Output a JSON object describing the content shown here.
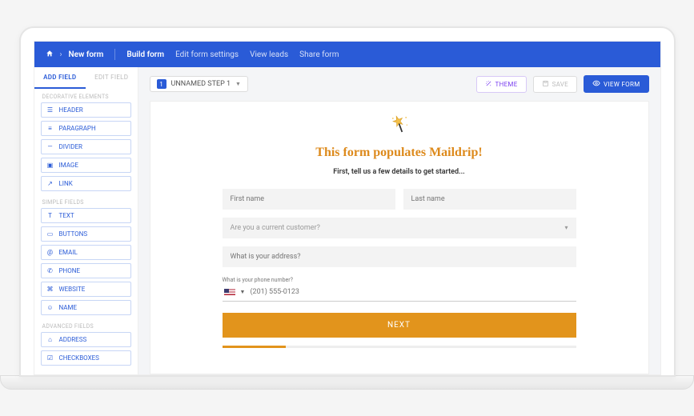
{
  "breadcrumb": {
    "current": "New form"
  },
  "nav": {
    "build": "Build form",
    "settings": "Edit form settings",
    "leads": "View leads",
    "share": "Share form"
  },
  "sidebar": {
    "tabs": {
      "add": "ADD FIELD",
      "edit": "EDIT FIELD"
    },
    "groups": {
      "decorative": "DECORATIVE ELEMENTS",
      "simple": "SIMPLE FIELDS",
      "advanced": "ADVANCED FIELDS"
    },
    "items": {
      "header": "HEADER",
      "paragraph": "PARAGRAPH",
      "divider": "DIVIDER",
      "image": "IMAGE",
      "link": "LINK",
      "text": "TEXT",
      "buttons": "BUTTONS",
      "email": "EMAIL",
      "phone": "PHONE",
      "website": "WEBSITE",
      "name": "NAME",
      "address": "ADDRESS",
      "checkboxes": "CHECKBOXES"
    }
  },
  "toolbar": {
    "step_badge": "1",
    "step_label": "UNNAMED STEP 1",
    "theme": "THEME",
    "save": "SAVE",
    "view": "VIEW FORM"
  },
  "form": {
    "title": "This form populates Maildrip!",
    "subtitle": "First, tell us a few details to get started...",
    "first_name_ph": "First name",
    "last_name_ph": "Last name",
    "customer_q": "Are you a current customer?",
    "address_ph": "What is your address?",
    "phone_label": "What is your phone number?",
    "phone_ph": "(201) 555-0123",
    "next": "NEXT"
  }
}
